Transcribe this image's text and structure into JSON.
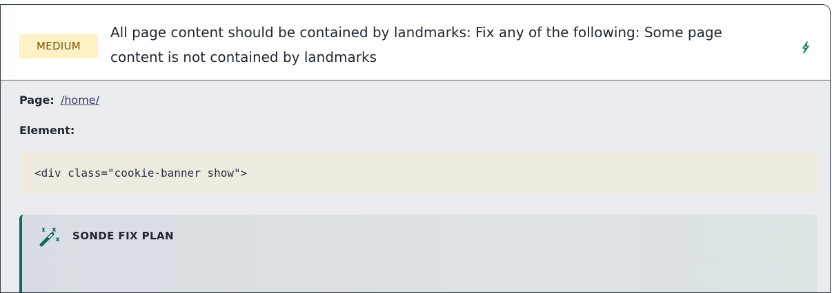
{
  "issue": {
    "severity": "MEDIUM",
    "title": "All page content should be contained by landmarks: Fix any of the following: Some page content is not contained by landmarks",
    "edit_icon": "lightning-icon"
  },
  "details": {
    "page_label": "Page:",
    "page_link": "/home/",
    "element_label": "Element:",
    "element_code": "<div class=\"cookie-banner show\">"
  },
  "fix_plan": {
    "icon": "magic-wand-icon",
    "title": "SONDE FIX PLAN"
  },
  "colors": {
    "badge_bg": "#fdf1c5",
    "badge_text": "#7a5807",
    "accent": "#0d6a5e",
    "code_bg": "#efebe1"
  }
}
